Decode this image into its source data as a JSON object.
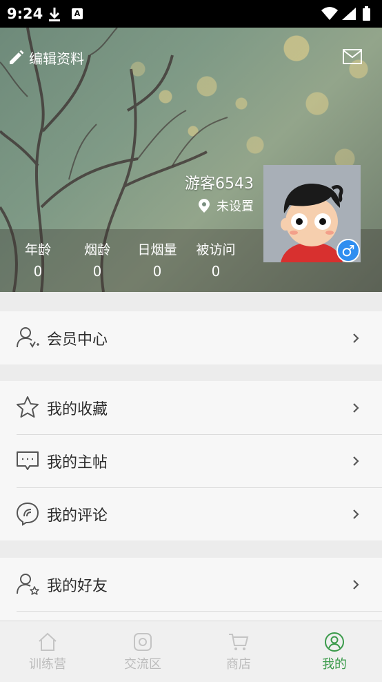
{
  "status_bar": {
    "time": "9:24"
  },
  "header": {
    "edit_label": "编辑资料",
    "username": "游客6543",
    "location": "未设置"
  },
  "stats": [
    {
      "label": "年龄",
      "value": "0"
    },
    {
      "label": "烟龄",
      "value": "0"
    },
    {
      "label": "日烟量",
      "value": "0"
    },
    {
      "label": "被访问",
      "value": "0"
    }
  ],
  "menu": {
    "member_center": "会员中心",
    "favorites": "我的收藏",
    "my_posts": "我的主帖",
    "my_comments": "我的评论",
    "my_friends": "我的好友"
  },
  "tabs": [
    {
      "label": "训练营",
      "icon": "home-icon",
      "active": false
    },
    {
      "label": "交流区",
      "icon": "camera-icon",
      "active": false
    },
    {
      "label": "商店",
      "icon": "cart-icon",
      "active": false
    },
    {
      "label": "我的",
      "icon": "profile-icon",
      "active": true
    }
  ],
  "colors": {
    "accent": "#3a9a4a",
    "gender_badge": "#2f8ef0"
  }
}
